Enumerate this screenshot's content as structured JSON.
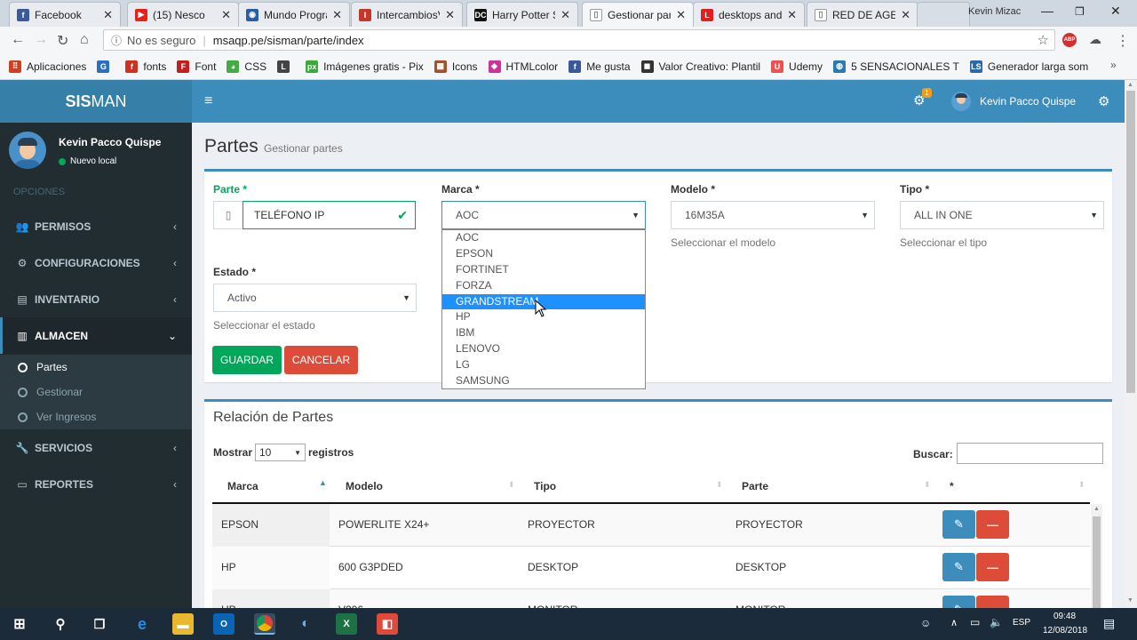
{
  "browser": {
    "tabs": [
      {
        "title": "Facebook",
        "icon": "facebook-icon",
        "color": "#3b5998",
        "glyph": "f"
      },
      {
        "title": "(15) Nesco",
        "icon": "youtube-icon",
        "color": "#e62117",
        "glyph": "▶"
      },
      {
        "title": "Mundo Progra",
        "icon": "globe-icon",
        "color": "#2a5da8",
        "glyph": "◉"
      },
      {
        "title": "IntercambiosV",
        "icon": "site-icon",
        "color": "#c0392b",
        "glyph": "I"
      },
      {
        "title": "Harry Potter S",
        "icon": "dc-icon",
        "color": "#111111",
        "glyph": "DC"
      },
      {
        "title": "Gestionar part",
        "icon": "page-icon",
        "color": "#ffffff",
        "glyph": "▯"
      },
      {
        "title": "desktops and",
        "icon": "site-icon",
        "color": "#e02020",
        "glyph": "L"
      },
      {
        "title": "RED DE AGEN",
        "icon": "page-icon",
        "color": "#ffffff",
        "glyph": "▯"
      }
    ],
    "profile_name": "Kevin Mizac",
    "security_label": "No es seguro",
    "url": "msaqp.pe/sisman/parte/index",
    "bookmarks": [
      {
        "label": "Aplicaciones",
        "color": "#d04020",
        "glyph": "⠿"
      },
      {
        "label": "",
        "color": "#2a70c0",
        "glyph": "G"
      },
      {
        "label": "fonts",
        "color": "#d03020",
        "glyph": "f"
      },
      {
        "label": "Font",
        "color": "#c02020",
        "glyph": "F"
      },
      {
        "label": "CSS",
        "color": "#44aa44",
        "glyph": "◕"
      },
      {
        "label": "",
        "color": "#444444",
        "glyph": "L"
      },
      {
        "label": "Imágenes gratis - Pix",
        "color": "#3aaa3a",
        "glyph": "px"
      },
      {
        "label": "Icons",
        "color": "#a0522d",
        "glyph": "▦"
      },
      {
        "label": "HTMLcolor",
        "color": "#cc3399",
        "glyph": "◆"
      },
      {
        "label": "Me gusta",
        "color": "#3b5998",
        "glyph": "f"
      },
      {
        "label": "Valor Creativo: Plantil",
        "color": "#333333",
        "glyph": "◼"
      },
      {
        "label": "Udemy",
        "color": "#ec5252",
        "glyph": "U"
      },
      {
        "label": "5 SENSACIONALES T",
        "color": "#2a7ab0",
        "glyph": "◍"
      },
      {
        "label": "Generador larga som",
        "color": "#2a6aaa",
        "glyph": "LS"
      }
    ]
  },
  "app": {
    "logo_bold": "SIS",
    "logo_rest": "MAN",
    "top_user": "Kevin Pacco Quispe",
    "notif_count": "1"
  },
  "sidebar": {
    "user_name": "Kevin Pacco Quispe",
    "status": "Nuevo local",
    "header": "OPCIONES",
    "items": [
      {
        "label": "PERMISOS",
        "icon": "users-icon",
        "glyph": "👥"
      },
      {
        "label": "CONFIGURACIONES",
        "icon": "cogs-icon",
        "glyph": "⚙"
      },
      {
        "label": "INVENTARIO",
        "icon": "list-icon",
        "glyph": "▤"
      },
      {
        "label": "ALMACEN",
        "icon": "building-icon",
        "glyph": "▥"
      },
      {
        "label": "SERVICIOS",
        "icon": "wrench-icon",
        "glyph": "🔧"
      },
      {
        "label": "REPORTES",
        "icon": "file-icon",
        "glyph": "▭"
      }
    ],
    "subitems": [
      "Partes",
      "Gestionar",
      "Ver Ingresos"
    ]
  },
  "page": {
    "title": "Partes",
    "subtitle": "Gestionar partes"
  },
  "form": {
    "parte_label": "Parte *",
    "parte_value": "TELÉFONO IP",
    "marca_label": "Marca *",
    "marca_value": "AOC",
    "modelo_label": "Modelo *",
    "modelo_value": "16M35A",
    "modelo_help": "Seleccionar el modelo",
    "tipo_label": "Tipo *",
    "tipo_value": "ALL IN ONE",
    "tipo_help": "Seleccionar el tipo",
    "estado_label": "Estado *",
    "estado_value": "Activo",
    "estado_help": "Seleccionar el estado",
    "save_label": "GUARDAR",
    "cancel_label": "CANCELAR",
    "marca_options": [
      "AOC",
      "EPSON",
      "FORTINET",
      "FORZA",
      "GRANDSTREAM",
      "HP",
      "IBM",
      "LENOVO",
      "LG",
      "SAMSUNG"
    ],
    "marca_highlighted": "GRANDSTREAM"
  },
  "table": {
    "title": "Relación de Partes",
    "show_label": "Mostrar",
    "show_value": "10",
    "records_label": "registros",
    "search_label": "Buscar:",
    "headers": [
      "Marca",
      "Modelo",
      "Tipo",
      "Parte",
      "*"
    ],
    "rows": [
      [
        "EPSON",
        "POWERLITE X24+",
        "PROYECTOR",
        "PROYECTOR"
      ],
      [
        "HP",
        "600 G3PDED",
        "DESKTOP",
        "DESKTOP"
      ],
      [
        "HP",
        "V206",
        "MONITOR",
        "MONITOR"
      ]
    ]
  },
  "taskbar": {
    "language": "ESP",
    "time": "09:48",
    "date": "12/08/2018"
  }
}
